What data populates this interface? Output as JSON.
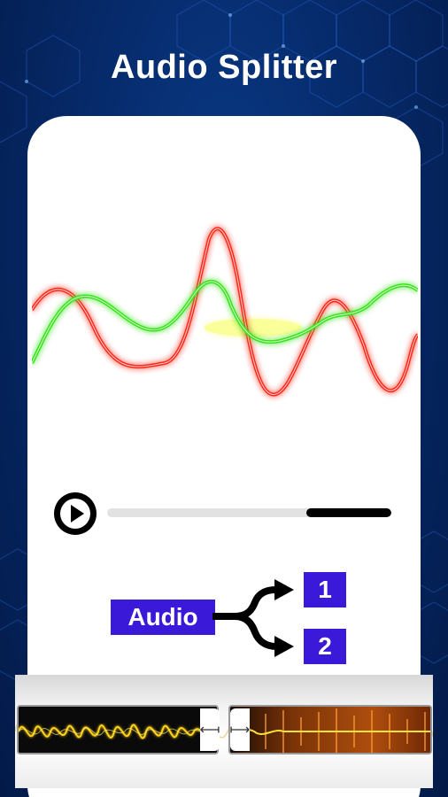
{
  "header": {
    "title": "Audio Splitter"
  },
  "player": {
    "progress": 0.3
  },
  "diagram": {
    "source_label": "Audio",
    "output_1": "1",
    "output_2": "2"
  },
  "icons": {
    "play": "play-icon",
    "split_arrow": "split-arrow-icon",
    "trim_left": "trim-handle-left-icon",
    "trim_right": "trim-handle-right-icon"
  },
  "colors": {
    "accent": "#3a19d8",
    "background": "#062a6a",
    "wave_red": "#ff2a1a",
    "wave_green": "#38e21c",
    "wave_yellow": "#e8f21a",
    "clip_left_wave": "#ffd21a",
    "clip_right_wave": "#ff7a10"
  }
}
